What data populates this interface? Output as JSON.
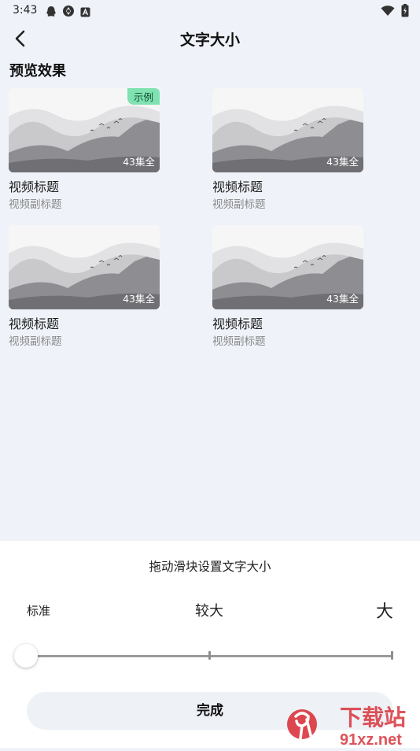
{
  "status": {
    "time": "3:43"
  },
  "header": {
    "title": "文字大小"
  },
  "preview": {
    "section_title": "预览效果",
    "badge": "示例",
    "cards": [
      {
        "title": "视频标题",
        "subtitle": "视频副标题",
        "episodes": "43集全"
      },
      {
        "title": "视频标题",
        "subtitle": "视频副标题",
        "episodes": "43集全"
      },
      {
        "title": "视频标题",
        "subtitle": "视频副标题",
        "episodes": "43集全"
      },
      {
        "title": "视频标题",
        "subtitle": "视频副标题",
        "episodes": "43集全"
      }
    ]
  },
  "font_panel": {
    "hint": "拖动滑块设置文字大小",
    "options": [
      "标准",
      "较大",
      "大"
    ],
    "selected_index": 0,
    "done_label": "完成"
  },
  "watermark": {
    "text_main": "下载站",
    "text_url": "91xz.net"
  },
  "colors": {
    "background": "#eff3f9",
    "badge": "#7fe2b0",
    "watermark": "#d9343d"
  }
}
